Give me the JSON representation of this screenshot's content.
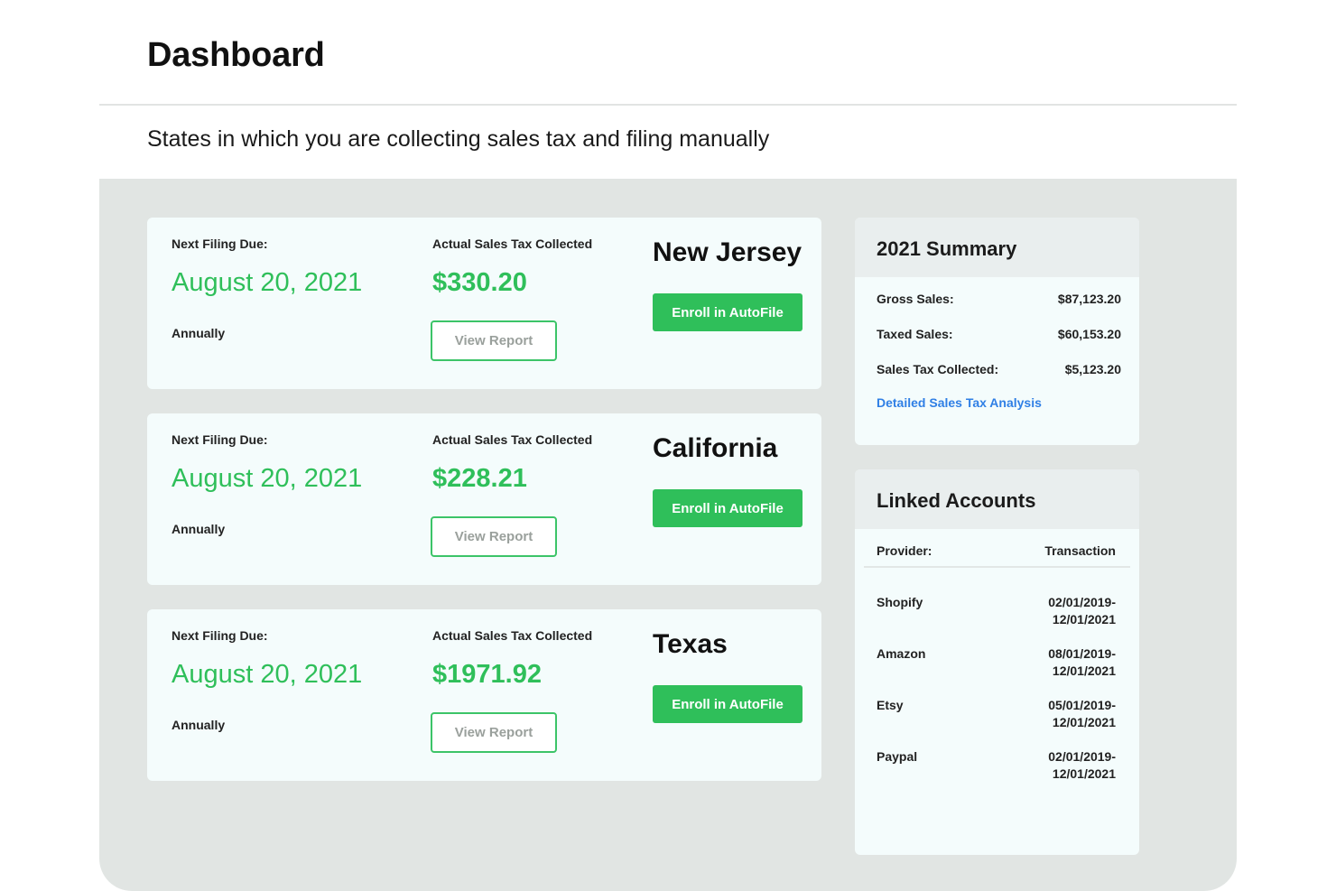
{
  "header": {
    "title": "Dashboard",
    "subtitle": "States in which you are collecting sales tax and filing manually"
  },
  "filings": [
    {
      "due_label": "Next Filing Due:",
      "due_date": "August 20, 2021",
      "frequency": "Annually",
      "tax_label": "Actual Sales Tax Collected",
      "tax_amount": "$330.20",
      "view_label": "View Report",
      "state": "New Jersey",
      "enroll_label": "Enroll in AutoFile"
    },
    {
      "due_label": "Next Filing Due:",
      "due_date": "August 20, 2021",
      "frequency": "Annually",
      "tax_label": "Actual Sales Tax Collected",
      "tax_amount": "$228.21",
      "view_label": "View Report",
      "state": "California",
      "enroll_label": "Enroll in AutoFile"
    },
    {
      "due_label": "Next Filing Due:",
      "due_date": "August 20, 2021",
      "frequency": "Annually",
      "tax_label": "Actual Sales Tax Collected",
      "tax_amount": "$1971.92",
      "view_label": "View Report",
      "state": "Texas",
      "enroll_label": "Enroll in AutoFile"
    }
  ],
  "summary": {
    "title": "2021 Summary",
    "rows": [
      {
        "label": "Gross Sales:",
        "value": "$87,123.20"
      },
      {
        "label": "Taxed Sales:",
        "value": "$60,153.20"
      },
      {
        "label": "Sales Tax Collected:",
        "value": "$5,123.20"
      }
    ],
    "link": "Detailed Sales Tax Analysis"
  },
  "linked_accounts": {
    "title": "Linked Accounts",
    "col_provider": "Provider:",
    "col_transaction": "Transaction",
    "rows": [
      {
        "provider": "Shopify",
        "start": "02/01/2019-",
        "end": "12/01/2021"
      },
      {
        "provider": "Amazon",
        "start": "08/01/2019-",
        "end": "12/01/2021"
      },
      {
        "provider": "Etsy",
        "start": "05/01/2019-",
        "end": "12/01/2021"
      },
      {
        "provider": "Paypal",
        "start": "02/01/2019-",
        "end": "12/01/2021"
      }
    ]
  },
  "colors": {
    "accent_green": "#2fbf5a",
    "link_blue": "#2f7fe5",
    "panel_bg": "#e1e5e3",
    "card_bg": "#f4fcfc"
  }
}
